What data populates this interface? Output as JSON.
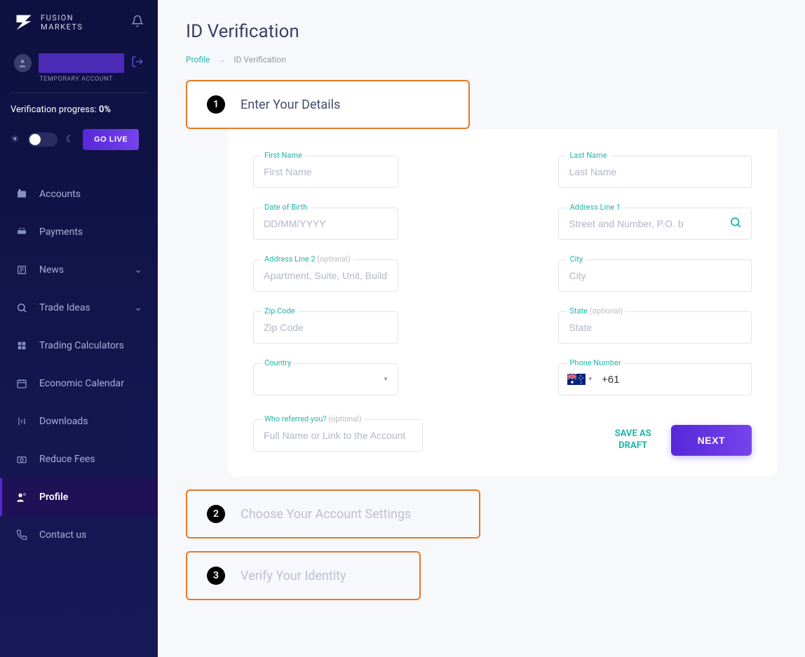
{
  "brand": {
    "line1": "FUSION",
    "line2": "MARKETS"
  },
  "user": {
    "temp_label": "TEMPORARY ACCOUNT"
  },
  "verification": {
    "label": "Verification progress:",
    "percent": "0%"
  },
  "go_live": "GO LIVE",
  "nav": {
    "accounts": "Accounts",
    "payments": "Payments",
    "news": "News",
    "trade_ideas": "Trade Ideas",
    "trading_calculators": "Trading Calculators",
    "economic_calendar": "Economic Calendar",
    "downloads": "Downloads",
    "reduce_fees": "Reduce Fees",
    "profile": "Profile",
    "contact_us": "Contact us"
  },
  "page": {
    "title": "ID Verification",
    "breadcrumb_profile": "Profile",
    "breadcrumb_current": "ID Verification"
  },
  "steps": {
    "one": {
      "num": "1",
      "title": "Enter Your Details"
    },
    "two": {
      "num": "2",
      "title": "Choose Your Account Settings"
    },
    "three": {
      "num": "3",
      "title": "Verify Your Identity"
    }
  },
  "form": {
    "first_name": {
      "label": "First Name",
      "placeholder": "First Name"
    },
    "last_name": {
      "label": "Last Name",
      "placeholder": "Last Name"
    },
    "dob": {
      "label": "Date of Birth",
      "placeholder": "DD/MM/YYYY"
    },
    "address1": {
      "label": "Address Line 1",
      "placeholder": "Street and Number, P.O. b"
    },
    "address2": {
      "label": "Address Line 2",
      "optional": "(optional)",
      "placeholder": "Apartment, Suite, Unit, Building e"
    },
    "city": {
      "label": "City",
      "placeholder": "City"
    },
    "zip": {
      "label": "Zip Code",
      "placeholder": "Zip Code"
    },
    "state": {
      "label": "State",
      "optional": "(optional)",
      "placeholder": "State"
    },
    "country": {
      "label": "Country"
    },
    "phone": {
      "label": "Phone Number",
      "value": "+61"
    },
    "referral": {
      "label": "Who referred you?",
      "optional": "(optional)",
      "placeholder": "Full Name or Link to the Account"
    }
  },
  "actions": {
    "save_draft_l1": "SAVE AS",
    "save_draft_l2": "DRAFT",
    "next": "NEXT"
  }
}
